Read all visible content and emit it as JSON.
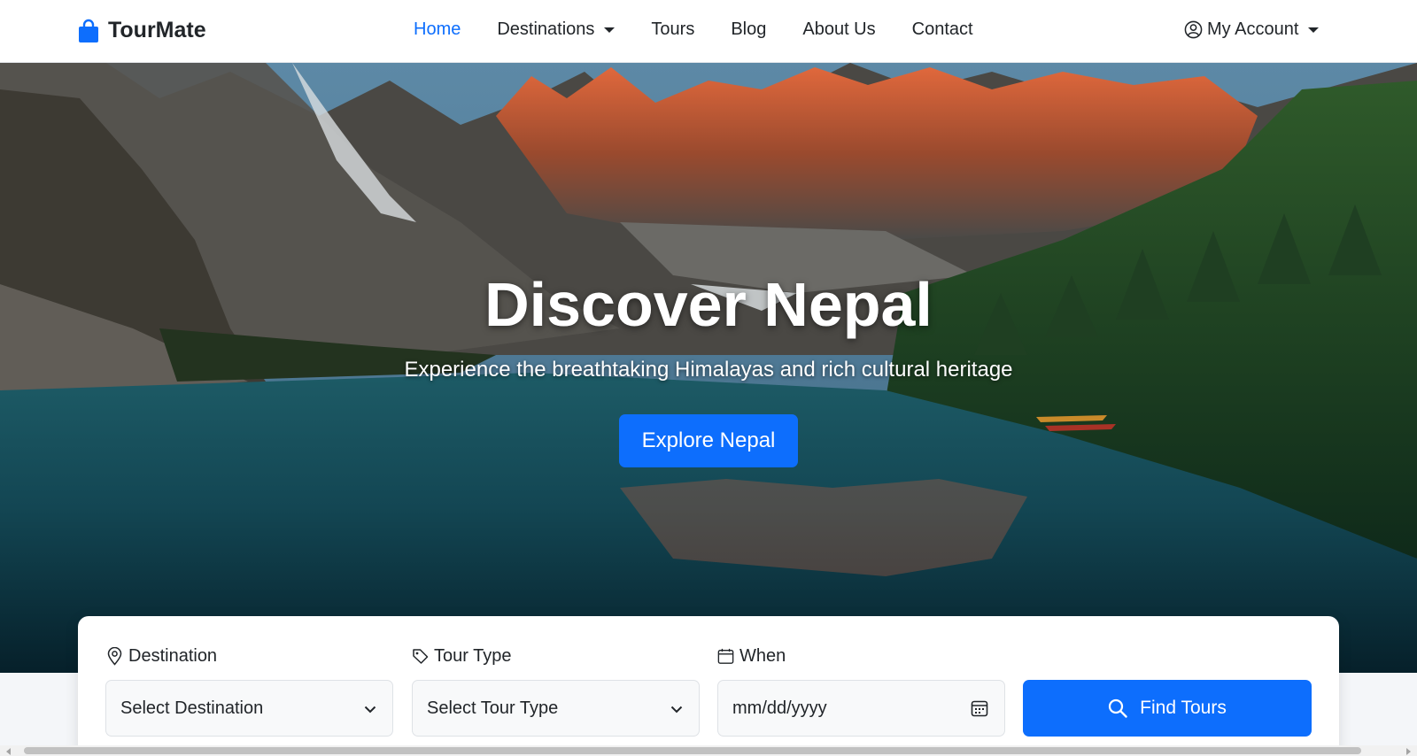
{
  "navbar": {
    "brand": "TourMate",
    "links": [
      {
        "label": "Home",
        "active": true
      },
      {
        "label": "Destinations",
        "dropdown": true
      },
      {
        "label": "Tours"
      },
      {
        "label": "Blog"
      },
      {
        "label": "About Us"
      },
      {
        "label": "Contact"
      }
    ],
    "account": {
      "label": "My Account",
      "icon": "person-circle-icon"
    }
  },
  "hero": {
    "title": "Discover Nepal",
    "subtitle": "Experience the breathtaking Himalayas and rich cultural heritage",
    "button": "Explore Nepal"
  },
  "search": {
    "destination": {
      "label": "Destination",
      "icon": "geo-pin-icon",
      "value": "Select Destination"
    },
    "tour_type": {
      "label": "Tour Type",
      "icon": "tag-icon",
      "value": "Select Tour Type"
    },
    "when": {
      "label": "When",
      "icon": "calendar-icon",
      "placeholder": "mm/dd/yyyy"
    },
    "submit": {
      "label": "Find Tours",
      "icon": "search-icon"
    }
  },
  "colors": {
    "primary": "#0d6efd",
    "text": "#212529",
    "navbar_bg": "#ffffff"
  }
}
